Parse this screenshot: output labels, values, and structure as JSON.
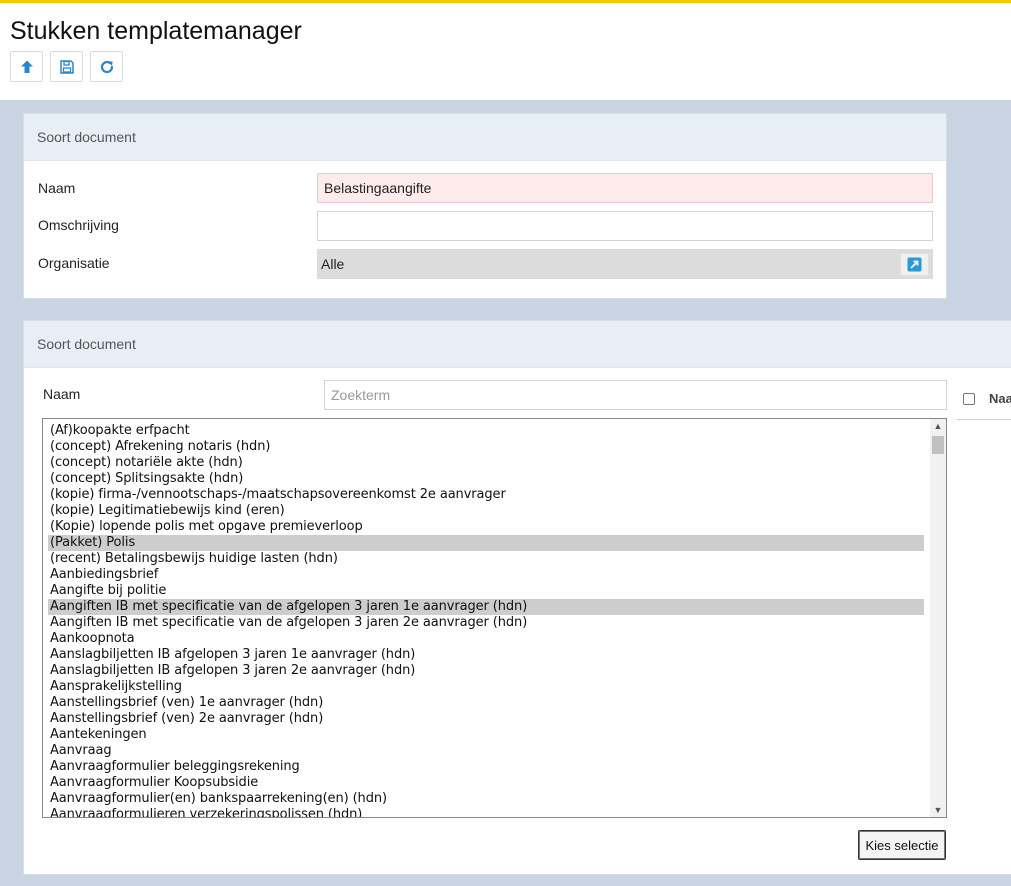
{
  "page": {
    "title": "Stukken templatemanager"
  },
  "toolbar": {
    "buttons": [
      {
        "icon": "arrow-up-icon"
      },
      {
        "icon": "save-icon"
      },
      {
        "icon": "refresh-icon"
      }
    ],
    "icon_color": "#2a86c8"
  },
  "form_panel": {
    "header": "Soort document",
    "naam_label": "Naam",
    "naam_value": "Belastingaangifte",
    "omschrijving_label": "Omschrijving",
    "omschrijving_value": "",
    "organisatie_label": "Organisatie",
    "organisatie_value": "Alle",
    "pick_icon": "external-link-icon"
  },
  "list_panel": {
    "header": "Soort document",
    "naam_label": "Naam",
    "search_placeholder": "Zoekterm",
    "column_header": "Naa",
    "items": [
      {
        "label": "(Af)koopakte erfpacht",
        "selected": false
      },
      {
        "label": "(concept) Afrekening notaris (hdn)",
        "selected": false
      },
      {
        "label": "(concept) notariële akte (hdn)",
        "selected": false
      },
      {
        "label": "(concept) Splitsingsakte (hdn)",
        "selected": false
      },
      {
        "label": "(kopie) firma-/vennootschaps-/maatschapsovereenkomst 2e aanvrager",
        "selected": false
      },
      {
        "label": "(kopie) Legitimatiebewijs kind (eren)",
        "selected": false
      },
      {
        "label": "(Kopie) lopende polis met opgave premieverloop",
        "selected": false
      },
      {
        "label": "(Pakket) Polis",
        "selected": true
      },
      {
        "label": "(recent) Betalingsbewijs huidige lasten (hdn)",
        "selected": false
      },
      {
        "label": "Aanbiedingsbrief",
        "selected": false
      },
      {
        "label": "Aangifte bij politie",
        "selected": false
      },
      {
        "label": "Aangiften IB met specificatie van de afgelopen 3 jaren 1e aanvrager (hdn)",
        "selected": true
      },
      {
        "label": "Aangiften IB met specificatie van de afgelopen 3 jaren 2e aanvrager (hdn)",
        "selected": false
      },
      {
        "label": "Aankoopnota",
        "selected": false
      },
      {
        "label": "Aanslagbiljetten IB afgelopen 3 jaren 1e aanvrager (hdn)",
        "selected": false
      },
      {
        "label": "Aanslagbiljetten IB afgelopen 3 jaren 2e aanvrager (hdn)",
        "selected": false
      },
      {
        "label": "Aansprakelijkstelling",
        "selected": false
      },
      {
        "label": "Aanstellingsbrief (ven) 1e aanvrager (hdn)",
        "selected": false
      },
      {
        "label": "Aanstellingsbrief (ven) 2e aanvrager (hdn)",
        "selected": false
      },
      {
        "label": "Aantekeningen",
        "selected": false
      },
      {
        "label": "Aanvraag",
        "selected": false
      },
      {
        "label": "Aanvraagformulier beleggingsrekening",
        "selected": false
      },
      {
        "label": "Aanvraagformulier Koopsubsidie",
        "selected": false
      },
      {
        "label": "Aanvraagformulier(en) bankspaarrekening(en) (hdn)",
        "selected": false
      },
      {
        "label": "Aanvraagformulieren verzekeringspolissen (hdn)",
        "selected": false
      }
    ],
    "select_button": "Kies selectie"
  }
}
